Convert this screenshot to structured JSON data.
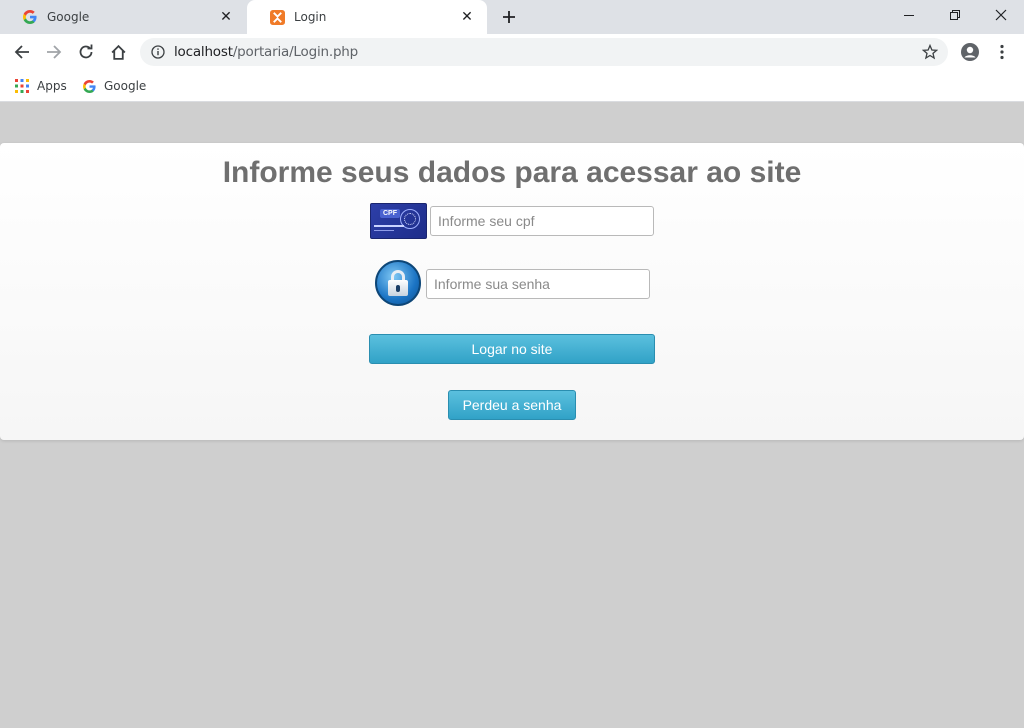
{
  "browser": {
    "tabs": [
      {
        "title": "Google",
        "icon": "google-icon",
        "active": false
      },
      {
        "title": "Login",
        "icon": "xampp-icon",
        "active": true
      }
    ],
    "url_host": "localhost",
    "url_path": "/portaria/Login.php",
    "bookmarks": [
      {
        "label": "Apps",
        "icon": "apps-grid-icon"
      },
      {
        "label": "Google",
        "icon": "google-icon"
      }
    ]
  },
  "page": {
    "title": "Informe seus dados para acessar ao site",
    "cpf_placeholder": "Informe seu cpf",
    "password_placeholder": "Informe sua senha",
    "cpf_card_label": "CPF",
    "login_button": "Logar no site",
    "forgot_button": "Perdeu a senha"
  },
  "colors": {
    "page_background": "#cfcfcf",
    "title_color": "#6f6f6f",
    "button_color": "#31a2c7"
  }
}
